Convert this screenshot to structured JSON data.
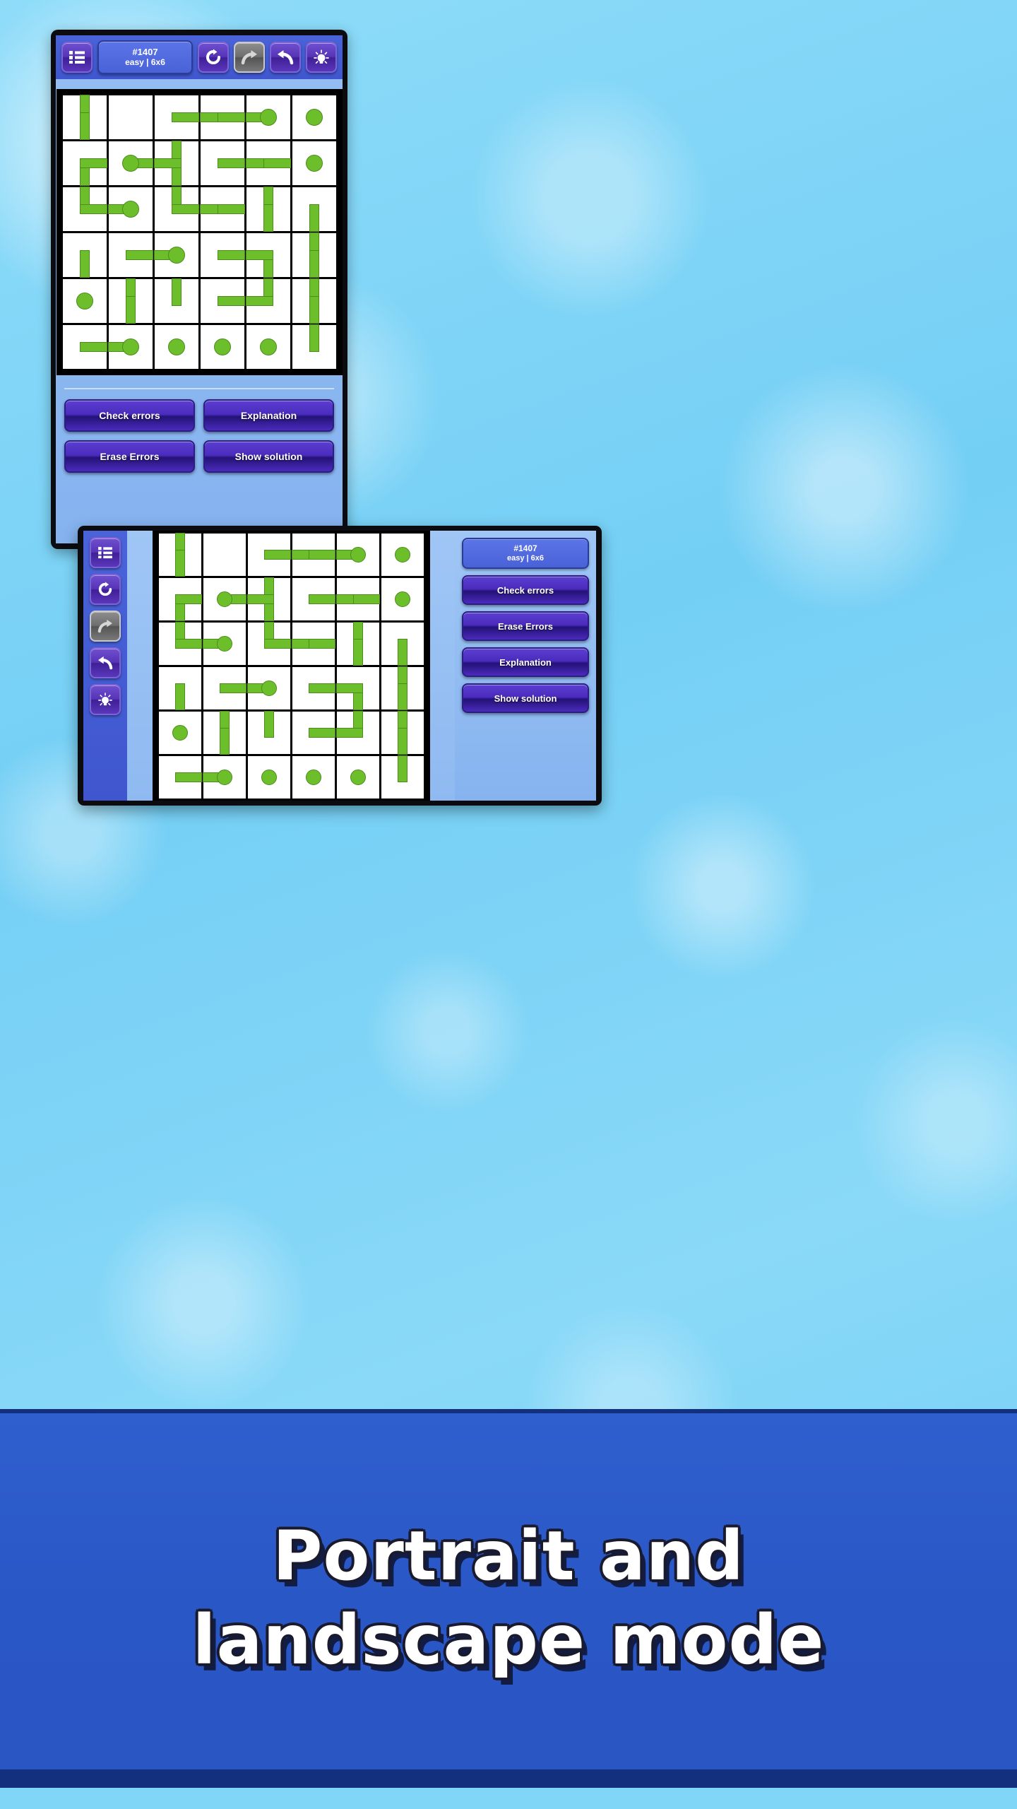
{
  "app": {
    "puzzle_id": "#1407",
    "puzzle_meta": "easy | 6x6",
    "grid_size": 6
  },
  "portrait": {
    "toolbar": {
      "menu_icon": "list-menu-icon",
      "restart_icon": "restart-circular-arrow-icon",
      "redo_icon": "redo-arrow-icon",
      "undo_icon": "undo-arrow-icon",
      "hint_icon": "lightbulb-hint-icon",
      "info_line1": "#1407",
      "info_line2": "easy | 6x6"
    },
    "actions": [
      {
        "label": "Check errors"
      },
      {
        "label": "Explanation"
      },
      {
        "label": "Erase Errors"
      },
      {
        "label": "Show solution"
      }
    ]
  },
  "landscape": {
    "rail_icons": [
      "list-menu-icon",
      "restart-circular-arrow-icon",
      "redo-arrow-icon",
      "undo-arrow-icon",
      "lightbulb-hint-icon"
    ],
    "info_line1": "#1407",
    "info_line2": "easy | 6x6",
    "actions": [
      {
        "label": "Check errors"
      },
      {
        "label": "Erase Errors"
      },
      {
        "label": "Explanation"
      },
      {
        "label": "Show solution"
      }
    ]
  },
  "caption": {
    "line1": "Portrait and",
    "line2": "landscape mode"
  },
  "colors": {
    "background": "#7fd6f7",
    "banner": "#2a57c6",
    "banner_border": "#13307f",
    "toolbar": "#4257d4",
    "button_purple": "#4a2bbd",
    "path_green": "#6cbe2b",
    "path_green_stroke": "#4c8c1d",
    "screen_panel": "#93bdf2",
    "disabled_gray": "#6e6e6e"
  },
  "chart_data": {
    "type": "table",
    "title": "6x6 path puzzle board state",
    "grid": {
      "rows": 6,
      "cols": 6,
      "legend": {
        "U": "segment up",
        "D": "segment down",
        "L": "segment left",
        "R": "segment right",
        "N": "node endpoint dot"
      },
      "cells": [
        [
          "UD",
          "",
          "R",
          "LR",
          "LN",
          "N"
        ],
        [
          "DR",
          "N R",
          "L U D",
          "R",
          "L R",
          "N"
        ],
        [
          "U R",
          "L N",
          "U R",
          "L R",
          "U D",
          "D"
        ],
        [
          "D",
          "R",
          "L N",
          "R",
          "L D",
          "U D"
        ],
        [
          "N",
          "U D",
          "U",
          "R",
          "L U",
          "U D"
        ],
        [
          "R",
          "L N",
          "N",
          "N",
          "N",
          "U"
        ]
      ]
    }
  }
}
